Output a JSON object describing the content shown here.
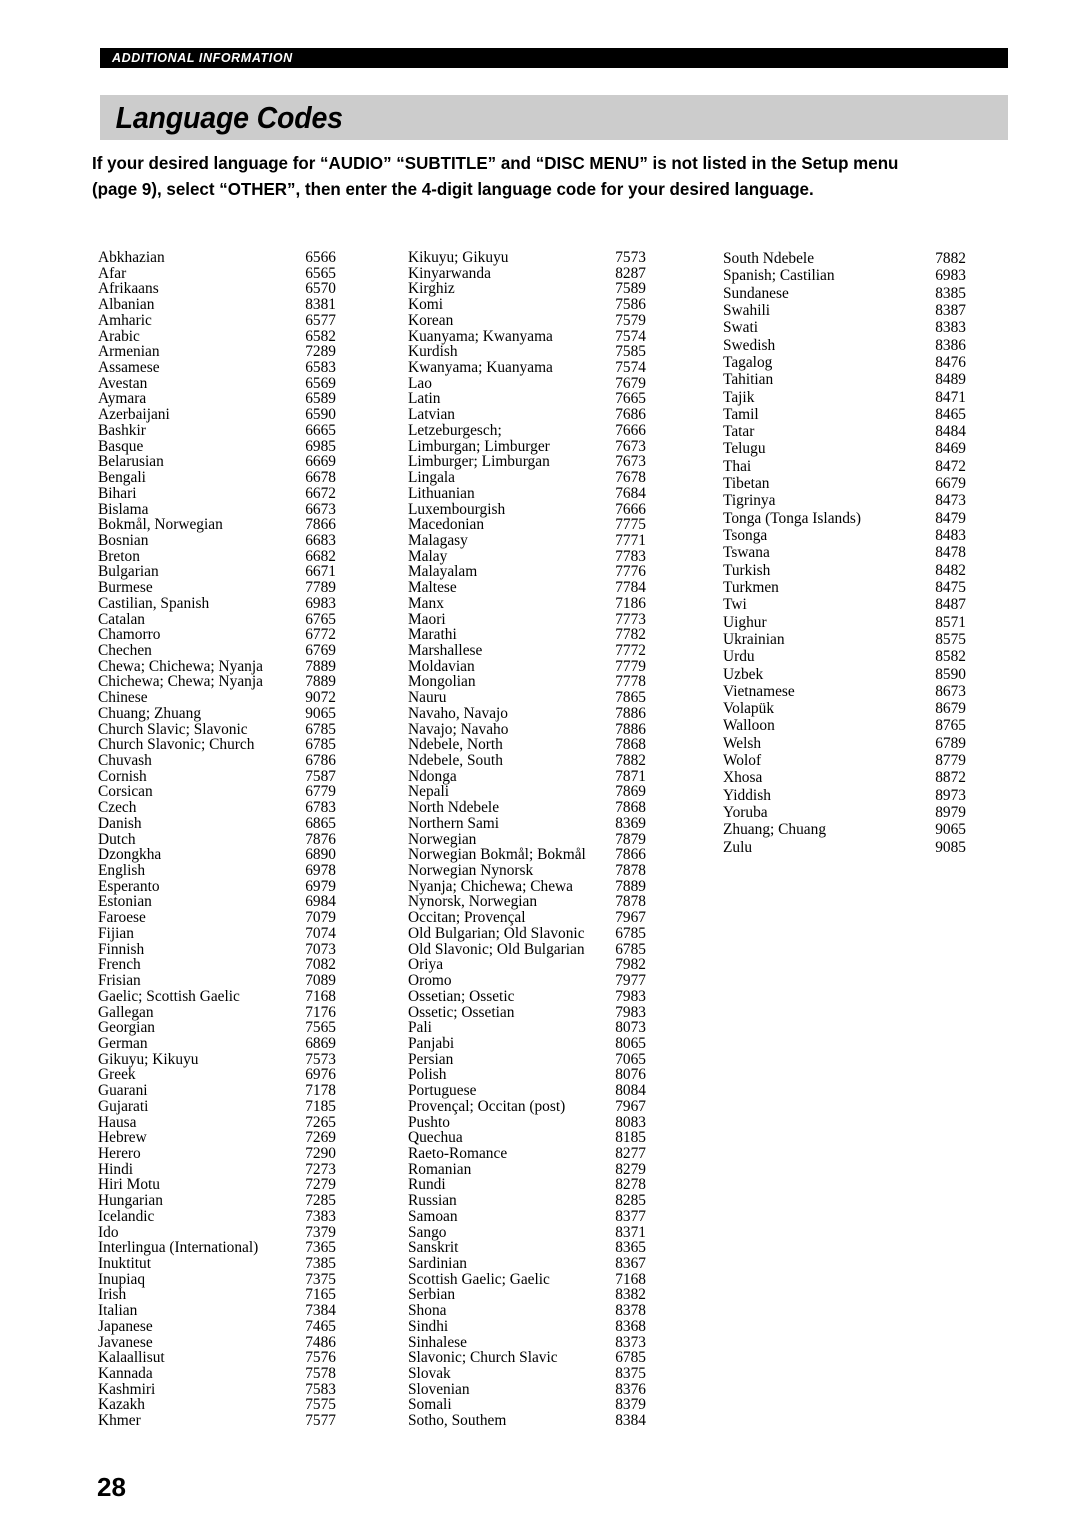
{
  "header": {
    "section_label": "ADDITIONAL INFORMATION",
    "title": "Language Codes"
  },
  "intro": {
    "line1": "If your desired language for “AUDIO” “SUBTITLE” and “DISC MENU” is not listed in the Setup menu",
    "line2": "(page 9), select “OTHER”, then enter the 4-digit language code for your desired language."
  },
  "footer": {
    "page_number": "28"
  },
  "columns": [
    {
      "id": "column-1",
      "rows": [
        {
          "name": "Abkhazian",
          "code": "6566"
        },
        {
          "name": "Afar",
          "code": "6565"
        },
        {
          "name": "Afrikaans",
          "code": "6570"
        },
        {
          "name": "Albanian",
          "code": "8381"
        },
        {
          "name": "Amharic",
          "code": "6577"
        },
        {
          "name": "Arabic",
          "code": "6582"
        },
        {
          "name": "Armenian",
          "code": "7289"
        },
        {
          "name": "Assamese",
          "code": "6583"
        },
        {
          "name": "Avestan",
          "code": "6569"
        },
        {
          "name": "Aymara",
          "code": "6589"
        },
        {
          "name": "Azerbaijani",
          "code": "6590"
        },
        {
          "name": "Bashkir",
          "code": "6665"
        },
        {
          "name": "Basque",
          "code": "6985"
        },
        {
          "name": "Belarusian",
          "code": "6669"
        },
        {
          "name": "Bengali",
          "code": "6678"
        },
        {
          "name": "Bihari",
          "code": "6672"
        },
        {
          "name": "Bislama",
          "code": "6673"
        },
        {
          "name": "Bokmål, Norwegian",
          "code": "7866"
        },
        {
          "name": "Bosnian",
          "code": "6683"
        },
        {
          "name": "Breton",
          "code": "6682"
        },
        {
          "name": "Bulgarian",
          "code": "6671"
        },
        {
          "name": "Burmese",
          "code": "7789"
        },
        {
          "name": "Castilian, Spanish",
          "code": "6983"
        },
        {
          "name": "Catalan",
          "code": "6765"
        },
        {
          "name": "Chamorro",
          "code": "6772"
        },
        {
          "name": "Chechen",
          "code": "6769"
        },
        {
          "name": "Chewa; Chichewa; Nyanja",
          "code": "7889"
        },
        {
          "name": "Chichewa; Chewa; Nyanja",
          "code": "7889"
        },
        {
          "name": "Chinese",
          "code": "9072"
        },
        {
          "name": "Chuang; Zhuang",
          "code": "9065"
        },
        {
          "name": "Church Slavic; Slavonic",
          "code": "6785"
        },
        {
          "name": "Church Slavonic; Church",
          "code": "6785"
        },
        {
          "name": "Chuvash",
          "code": "6786"
        },
        {
          "name": "Cornish",
          "code": "7587"
        },
        {
          "name": "Corsican",
          "code": "6779"
        },
        {
          "name": "Czech",
          "code": "6783"
        },
        {
          "name": "Danish",
          "code": "6865"
        },
        {
          "name": "Dutch",
          "code": "7876"
        },
        {
          "name": "Dzongkha",
          "code": "6890"
        },
        {
          "name": "English",
          "code": "6978"
        },
        {
          "name": "Esperanto",
          "code": "6979"
        },
        {
          "name": "Estonian",
          "code": "6984"
        },
        {
          "name": "Faroese",
          "code": "7079"
        },
        {
          "name": "Fijian",
          "code": "7074"
        },
        {
          "name": "Finnish",
          "code": "7073"
        },
        {
          "name": "French",
          "code": "7082"
        },
        {
          "name": "Frisian",
          "code": "7089"
        },
        {
          "name": "Gaelic; Scottish Gaelic",
          "code": "7168"
        },
        {
          "name": "Gallegan",
          "code": "7176"
        },
        {
          "name": "Georgian",
          "code": "7565"
        },
        {
          "name": "German",
          "code": "6869"
        },
        {
          "name": "Gikuyu; Kikuyu",
          "code": "7573"
        },
        {
          "name": "Greek",
          "code": "6976"
        },
        {
          "name": "Guarani",
          "code": "7178"
        },
        {
          "name": "Gujarati",
          "code": "7185"
        },
        {
          "name": "Hausa",
          "code": "7265"
        },
        {
          "name": "Hebrew",
          "code": "7269"
        },
        {
          "name": "Herero",
          "code": "7290"
        },
        {
          "name": "Hindi",
          "code": "7273"
        },
        {
          "name": "Hiri Motu",
          "code": "7279"
        },
        {
          "name": "Hungarian",
          "code": "7285"
        },
        {
          "name": "Icelandic",
          "code": "7383"
        },
        {
          "name": "Ido",
          "code": "7379"
        },
        {
          "name": "Interlingua (International)",
          "code": "7365"
        },
        {
          "name": "Inuktitut",
          "code": "7385"
        },
        {
          "name": "Inupiaq",
          "code": "7375"
        },
        {
          "name": "Irish",
          "code": "7165"
        },
        {
          "name": "Italian",
          "code": "7384"
        },
        {
          "name": "Japanese",
          "code": "7465"
        },
        {
          "name": "Javanese",
          "code": "7486"
        },
        {
          "name": "Kalaallisut",
          "code": "7576"
        },
        {
          "name": "Kannada",
          "code": "7578"
        },
        {
          "name": "Kashmiri",
          "code": "7583"
        },
        {
          "name": "Kazakh",
          "code": "7575"
        },
        {
          "name": "Khmer",
          "code": "7577"
        }
      ]
    },
    {
      "id": "column-2",
      "rows": [
        {
          "name": "Kikuyu; Gikuyu",
          "code": "7573"
        },
        {
          "name": "Kinyarwanda",
          "code": "8287"
        },
        {
          "name": "Kirghiz",
          "code": "7589"
        },
        {
          "name": "Komi",
          "code": "7586"
        },
        {
          "name": "Korean",
          "code": "7579"
        },
        {
          "name": "Kuanyama; Kwanyama",
          "code": "7574"
        },
        {
          "name": "Kurdish",
          "code": "7585"
        },
        {
          "name": "Kwanyama; Kuanyama",
          "code": "7574"
        },
        {
          "name": "Lao",
          "code": "7679"
        },
        {
          "name": "Latin",
          "code": "7665"
        },
        {
          "name": "Latvian",
          "code": "7686"
        },
        {
          "name": "Letzeburgesch;",
          "code": "7666"
        },
        {
          "name": "Limburgan; Limburger",
          "code": "7673"
        },
        {
          "name": "Limburger; Limburgan",
          "code": "7673"
        },
        {
          "name": "Lingala",
          "code": "7678"
        },
        {
          "name": "Lithuanian",
          "code": "7684"
        },
        {
          "name": "Luxembourgish",
          "code": "7666"
        },
        {
          "name": "Macedonian",
          "code": "7775"
        },
        {
          "name": "Malagasy",
          "code": "7771"
        },
        {
          "name": "Malay",
          "code": "7783"
        },
        {
          "name": "Malayalam",
          "code": "7776"
        },
        {
          "name": "Maltese",
          "code": "7784"
        },
        {
          "name": "Manx",
          "code": "7186"
        },
        {
          "name": "Maori",
          "code": "7773"
        },
        {
          "name": "Marathi",
          "code": "7782"
        },
        {
          "name": "Marshallese",
          "code": "7772"
        },
        {
          "name": "Moldavian",
          "code": "7779"
        },
        {
          "name": "Mongolian",
          "code": "7778"
        },
        {
          "name": "Nauru",
          "code": "7865"
        },
        {
          "name": "Navaho, Navajo",
          "code": "7886"
        },
        {
          "name": "Navajo; Navaho",
          "code": "7886"
        },
        {
          "name": "Ndebele, North",
          "code": "7868"
        },
        {
          "name": "Ndebele, South",
          "code": "7882"
        },
        {
          "name": "Ndonga",
          "code": "7871"
        },
        {
          "name": "Nepali",
          "code": "7869"
        },
        {
          "name": "North Ndebele",
          "code": "7868"
        },
        {
          "name": "Northern Sami",
          "code": "8369"
        },
        {
          "name": "Norwegian",
          "code": "7879"
        },
        {
          "name": "Norwegian Bokmål; Bokmål",
          "code": "7866"
        },
        {
          "name": "Norwegian Nynorsk",
          "code": "7878"
        },
        {
          "name": "Nyanja; Chichewa; Chewa",
          "code": "7889"
        },
        {
          "name": "Nynorsk, Norwegian",
          "code": "7878"
        },
        {
          "name": "Occitan; Provençal",
          "code": "7967"
        },
        {
          "name": "Old Bulgarian; Old Slavonic",
          "code": "6785"
        },
        {
          "name": "Old Slavonic; Old Bulgarian",
          "code": "6785"
        },
        {
          "name": "Oriya",
          "code": "7982"
        },
        {
          "name": "Oromo",
          "code": "7977"
        },
        {
          "name": "Ossetian; Ossetic",
          "code": "7983"
        },
        {
          "name": "Ossetic; Ossetian",
          "code": "7983"
        },
        {
          "name": "Pali",
          "code": "8073"
        },
        {
          "name": "Panjabi",
          "code": "8065"
        },
        {
          "name": "Persian",
          "code": "7065"
        },
        {
          "name": "Polish",
          "code": "8076"
        },
        {
          "name": "Portuguese",
          "code": "8084"
        },
        {
          "name": "Provençal; Occitan (post)",
          "code": "7967"
        },
        {
          "name": "Pushto",
          "code": "8083"
        },
        {
          "name": "Quechua",
          "code": "8185"
        },
        {
          "name": "Raeto-Romance",
          "code": "8277"
        },
        {
          "name": "Romanian",
          "code": "8279"
        },
        {
          "name": "Rundi",
          "code": "8278"
        },
        {
          "name": "Russian",
          "code": "8285"
        },
        {
          "name": "Samoan",
          "code": "8377"
        },
        {
          "name": "Sango",
          "code": "8371"
        },
        {
          "name": "Sanskrit",
          "code": "8365"
        },
        {
          "name": "Sardinian",
          "code": "8367"
        },
        {
          "name": "Scottish Gaelic; Gaelic",
          "code": "7168"
        },
        {
          "name": "Serbian",
          "code": "8382"
        },
        {
          "name": "Shona",
          "code": "8378"
        },
        {
          "name": "Sindhi",
          "code": "8368"
        },
        {
          "name": "Sinhalese",
          "code": "8373"
        },
        {
          "name": "Slavonic; Church Slavic",
          "code": "6785"
        },
        {
          "name": "Slovak",
          "code": "8375"
        },
        {
          "name": "Slovenian",
          "code": "8376"
        },
        {
          "name": "Somali",
          "code": "8379"
        },
        {
          "name": "Sotho, Southem",
          "code": "8384"
        }
      ]
    },
    {
      "id": "column-3",
      "rows": [
        {
          "name": "South Ndebele",
          "code": "7882"
        },
        {
          "name": "Spanish; Castilian",
          "code": "6983"
        },
        {
          "name": "Sundanese",
          "code": "8385"
        },
        {
          "name": "Swahili",
          "code": "8387"
        },
        {
          "name": "Swati",
          "code": "8383"
        },
        {
          "name": "Swedish",
          "code": "8386"
        },
        {
          "name": "Tagalog",
          "code": "8476"
        },
        {
          "name": "Tahitian",
          "code": "8489"
        },
        {
          "name": "Tajik",
          "code": "8471"
        },
        {
          "name": "Tamil",
          "code": "8465"
        },
        {
          "name": "Tatar",
          "code": "8484"
        },
        {
          "name": "Telugu",
          "code": "8469"
        },
        {
          "name": "Thai",
          "code": "8472"
        },
        {
          "name": "Tibetan",
          "code": "6679"
        },
        {
          "name": "Tigrinya",
          "code": "8473"
        },
        {
          "name": "Tonga (Tonga Islands)",
          "code": "8479"
        },
        {
          "name": "Tsonga",
          "code": "8483"
        },
        {
          "name": "Tswana",
          "code": "8478"
        },
        {
          "name": "Turkish",
          "code": "8482"
        },
        {
          "name": "Turkmen",
          "code": "8475"
        },
        {
          "name": "Twi",
          "code": "8487"
        },
        {
          "name": "Uighur",
          "code": "8571"
        },
        {
          "name": "Ukrainian",
          "code": "8575"
        },
        {
          "name": "Urdu",
          "code": "8582"
        },
        {
          "name": "Uzbek",
          "code": "8590"
        },
        {
          "name": "Vietnamese",
          "code": "8673"
        },
        {
          "name": "Volapük",
          "code": "8679"
        },
        {
          "name": "Walloon",
          "code": "8765"
        },
        {
          "name": "Welsh",
          "code": "6789"
        },
        {
          "name": "Wolof",
          "code": "8779"
        },
        {
          "name": "Xhosa",
          "code": "8872"
        },
        {
          "name": "Yiddish",
          "code": "8973"
        },
        {
          "name": "Yoruba",
          "code": "8979"
        },
        {
          "name": "Zhuang; Chuang",
          "code": "9065"
        },
        {
          "name": "Zulu",
          "code": "9085"
        }
      ]
    }
  ]
}
